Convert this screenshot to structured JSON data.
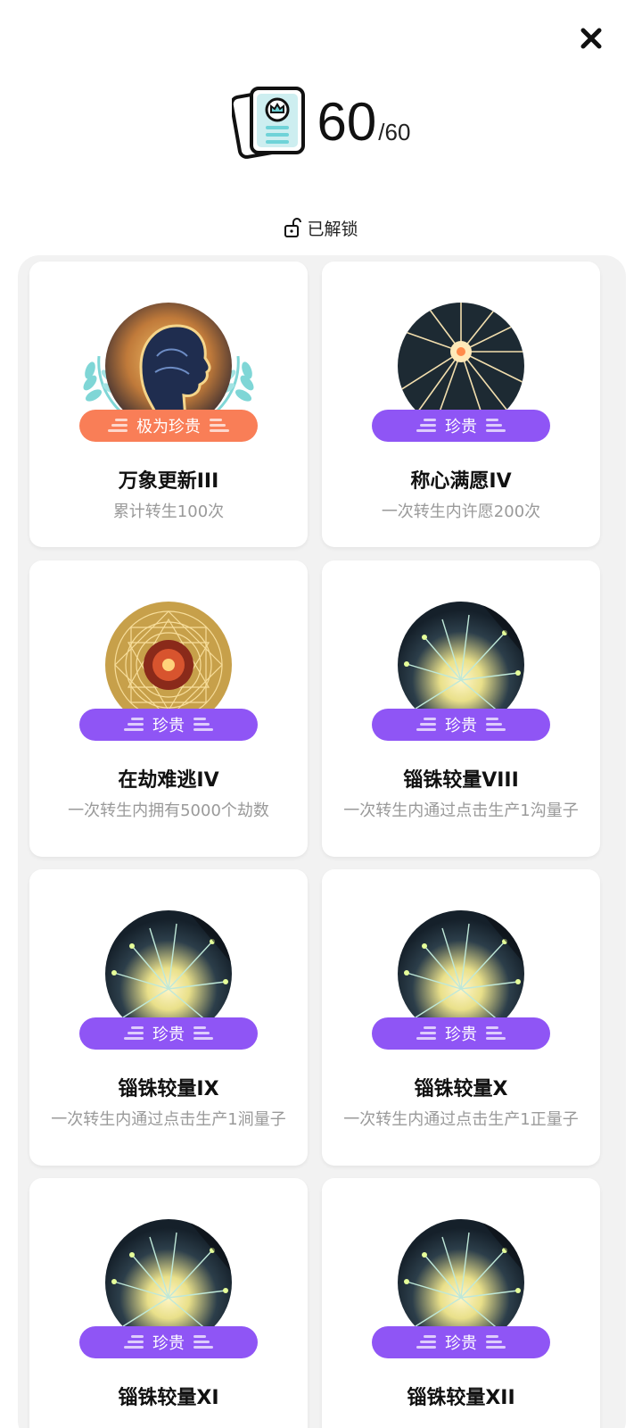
{
  "header": {
    "count": "60",
    "total": "/60"
  },
  "section": {
    "title": "已解锁"
  },
  "colors": {
    "rare_badge": "#8f55f5",
    "epic_badge": "#f97e57",
    "background": "#f2f2f2"
  },
  "achievements": [
    {
      "name": "万象更新III",
      "desc": "累计转生100次",
      "rarity": "极为珍贵",
      "art": "head-silhouette"
    },
    {
      "name": "称心满愿IV",
      "desc": "一次转生内许愿200次",
      "rarity": "珍贵",
      "art": "starburst"
    },
    {
      "name": "在劫难逃IV",
      "desc": "一次转生内拥有5000个劫数",
      "rarity": "珍贵",
      "art": "mandala"
    },
    {
      "name": "锱铢较量VIII",
      "desc": "一次转生内通过点击生产1沟量子",
      "rarity": "珍贵",
      "art": "energy-burst"
    },
    {
      "name": "锱铢较量IX",
      "desc": "一次转生内通过点击生产1涧量子",
      "rarity": "珍贵",
      "art": "energy-burst"
    },
    {
      "name": "锱铢较量X",
      "desc": "一次转生内通过点击生产1正量子",
      "rarity": "珍贵",
      "art": "energy-burst"
    },
    {
      "name": "锱铢较量XI",
      "desc": "",
      "rarity": "珍贵",
      "art": "energy-burst"
    },
    {
      "name": "锱铢较量XII",
      "desc": "",
      "rarity": "珍贵",
      "art": "energy-burst"
    }
  ]
}
